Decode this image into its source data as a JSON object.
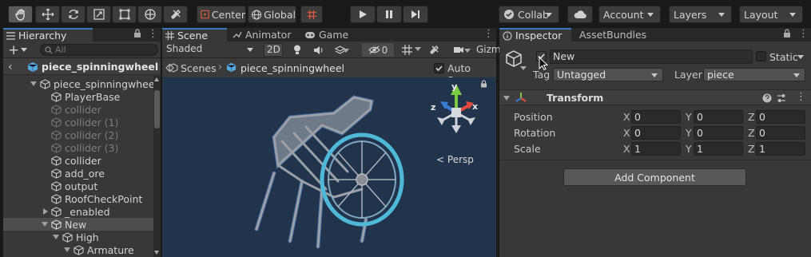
{
  "toolbar": {
    "pivot_label": "Center",
    "space_label": "Global",
    "collab_label": "Collab",
    "account_label": "Account",
    "layers_label": "Layers",
    "layout_label": "Layout"
  },
  "hierarchy": {
    "tab_label": "Hierarchy",
    "search_placeholder": "All",
    "root_label": "piece_spinningwheel",
    "items": [
      {
        "label": "piece_spinningwheel"
      },
      {
        "label": "PlayerBase"
      },
      {
        "label": "collider"
      },
      {
        "label": "collider (1)"
      },
      {
        "label": "collider (2)"
      },
      {
        "label": "collider (3)"
      },
      {
        "label": "collider"
      },
      {
        "label": "add_ore"
      },
      {
        "label": "output"
      },
      {
        "label": "RoofCheckPoint"
      },
      {
        "label": "_enabled"
      },
      {
        "label": "New"
      },
      {
        "label": "High"
      },
      {
        "label": "Armature"
      }
    ]
  },
  "scene": {
    "tabs": [
      {
        "label": "Scene"
      },
      {
        "label": "Animator"
      },
      {
        "label": "Game"
      }
    ],
    "shading_mode": "Shaded",
    "mode_2d": "2D",
    "hidden_count": "0",
    "gizmos_label": "Gizm",
    "breadcrumb_root": "Scenes",
    "breadcrumb_current": "piece_spinningwheel",
    "auto_save_label": "Auto Save",
    "gizmo_axis_y": "y",
    "gizmo_axis_x": "x",
    "gizmo_axis_z": "z",
    "projection_label": "Persp"
  },
  "inspector": {
    "tabs": [
      {
        "label": "Inspector"
      },
      {
        "label": "AssetBundles"
      }
    ],
    "object_name": "New",
    "static_label": "Static",
    "tag_label": "Tag",
    "tag_value": "Untagged",
    "layer_label": "Layer",
    "layer_value": "piece",
    "component_title": "Transform",
    "rows": [
      {
        "label": "Position",
        "x": "0",
        "y": "0",
        "z": "0"
      },
      {
        "label": "Rotation",
        "x": "0",
        "y": "0",
        "z": "0"
      },
      {
        "label": "Scale",
        "x": "1",
        "y": "1",
        "z": "1"
      }
    ],
    "axis_labels": {
      "x": "X",
      "y": "Y",
      "z": "Z"
    },
    "add_component_label": "Add Component"
  },
  "colors": {
    "accent": "#3a79bb",
    "scene_background": "#22344c",
    "selection_outline": "#5b8fd6"
  }
}
